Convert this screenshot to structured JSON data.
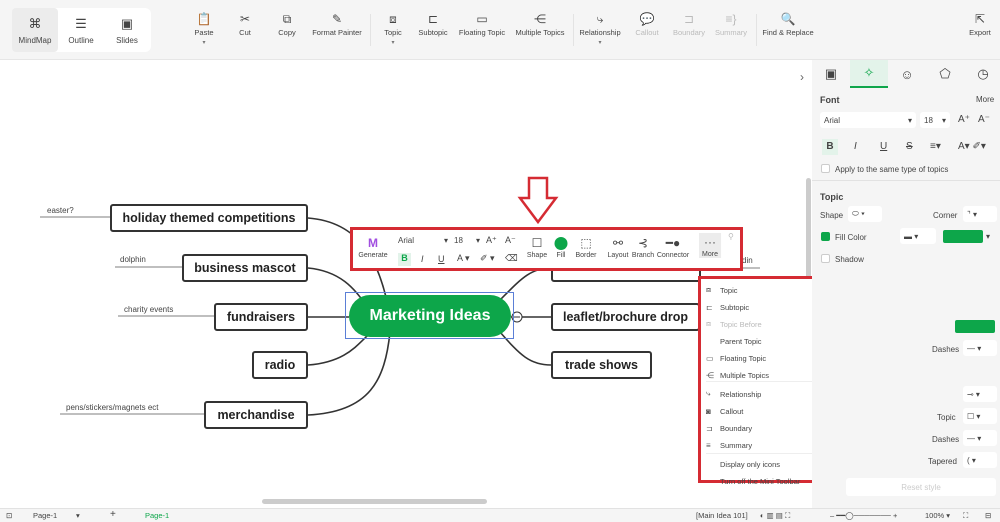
{
  "views": [
    {
      "label": "MindMap",
      "icon": "mindmap-icon",
      "active": true
    },
    {
      "label": "Outline",
      "icon": "outline-icon"
    },
    {
      "label": "Slides",
      "icon": "slides-icon"
    }
  ],
  "toolbar": {
    "paste": "Paste",
    "cut": "Cut",
    "copy": "Copy",
    "format_painter": "Format Painter",
    "topic": "Topic",
    "subtopic": "Subtopic",
    "floating_topic": "Floating Topic",
    "multiple_topics": "Multiple Topics",
    "relationship": "Relationship",
    "callout": "Callout",
    "boundary": "Boundary",
    "summary": "Summary",
    "find_replace": "Find & Replace",
    "export": "Export"
  },
  "mindmap": {
    "center": "Marketing Ideas",
    "left": [
      {
        "text": "holiday themed competitions",
        "note": "easter?"
      },
      {
        "text": "business mascot",
        "note": "dolphin"
      },
      {
        "text": "fundraisers",
        "note": "charity events"
      },
      {
        "text": "radio"
      },
      {
        "text": "merchandise",
        "note": "pens/stickers/magnets ect"
      }
    ],
    "right": [
      {
        "text": "",
        "note": "din"
      },
      {
        "text": "leaflet/brochure drop"
      },
      {
        "text": "trade shows"
      }
    ]
  },
  "mini_toolbar": {
    "generate": "Generate",
    "font": "Arial",
    "size": "18",
    "shape": "Shape",
    "fill": "Fill",
    "border": "Border",
    "layout": "Layout",
    "branch": "Branch",
    "connector": "Connector",
    "more": "More",
    "bold": "B",
    "italic": "I",
    "underline": "U",
    "font_color": "A"
  },
  "context_menu": [
    {
      "label": "Topic",
      "key": "Enter",
      "icon": "topic-icon"
    },
    {
      "label": "Subtopic",
      "key": "Tab, Ins, Ctrl+Enter",
      "icon": "subtopic-icon"
    },
    {
      "label": "Topic Before",
      "key": "Shift+Enter",
      "icon": "topic-before-icon",
      "disabled": true
    },
    {
      "label": "Parent Topic",
      "key": "Shift+Ins"
    },
    {
      "label": "Floating Topic",
      "key": "Alt+F",
      "icon": "floating-topic-icon"
    },
    {
      "label": "Multiple Topics",
      "key": "Ctrl+M",
      "icon": "multiple-topics-icon"
    },
    {
      "label": "Relationship",
      "key": "Ctrl+R",
      "icon": "relationship-icon"
    },
    {
      "label": "Callout",
      "key": "Alt+Enter",
      "icon": "callout-icon"
    },
    {
      "label": "Boundary",
      "key": "Ctrl+Shift+B",
      "icon": "boundary-icon"
    },
    {
      "label": "Summary",
      "key": "Ctrl+]",
      "icon": "summary-icon"
    },
    {
      "label": "Display only icons"
    },
    {
      "label": "Turn off the Mini Toolbar"
    }
  ],
  "panel": {
    "font_title": "Font",
    "more": "More",
    "font": "Arial",
    "size": "18",
    "apply_same": "Apply to the same type of topics",
    "topic_title": "Topic",
    "shape": "Shape",
    "corner": "Corner",
    "fill_color": "Fill Color",
    "shadow": "Shadow",
    "dashes": "Dashes",
    "topic": "Topic",
    "dashes2": "Dashes",
    "tapered": "Tapered",
    "reset": "Reset style"
  },
  "status": {
    "page_select": "Page-1",
    "page_tab": "Page-1",
    "info": "[Main Idea 101]",
    "zoom": "100%"
  },
  "colors": {
    "accent": "#0da64a",
    "highlight": "#d52b33",
    "selection": "#5b7fd6"
  }
}
